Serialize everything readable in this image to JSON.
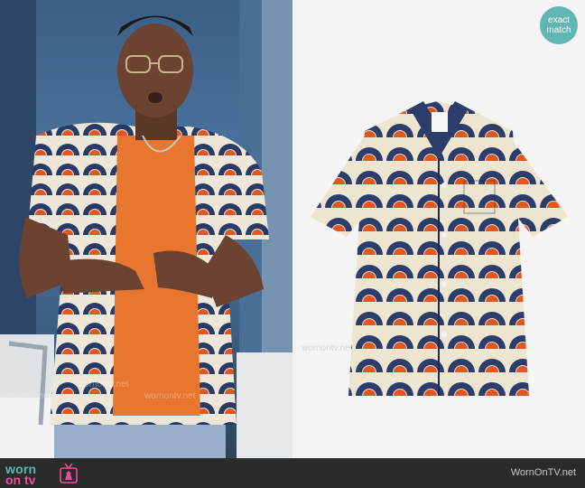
{
  "badge": {
    "line1": "exact",
    "line2": "match"
  },
  "footer": {
    "logo_top": "worn",
    "logo_bottom": "on tv",
    "site_url": "WornOnTV.net"
  },
  "watermark": {
    "text": "wornontv.net"
  },
  "colors": {
    "badge": "#5fb6b3",
    "logo_teal": "#5fb6b3",
    "logo_pink": "#e84f97",
    "footer_bg": "#2b2b2b"
  }
}
